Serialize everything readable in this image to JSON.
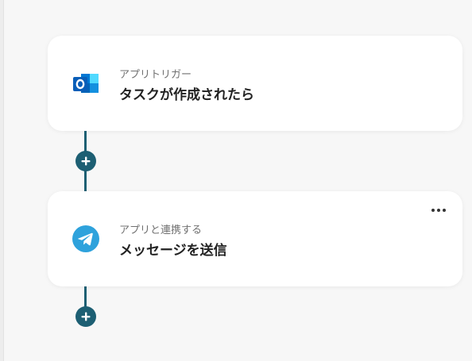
{
  "flow": {
    "steps": [
      {
        "subtitle": "アプリトリガー",
        "title": "タスクが作成されたら",
        "icon": "outlook-icon"
      },
      {
        "subtitle": "アプリと連携する",
        "title": "メッセージを送信",
        "icon": "telegram-icon"
      }
    ]
  },
  "colors": {
    "connector": "#1d5f73",
    "outlook": "#0a64c9",
    "telegram": "#2ea2dc"
  },
  "icons": {
    "add": "plus-icon",
    "more": "more-dots-icon"
  }
}
